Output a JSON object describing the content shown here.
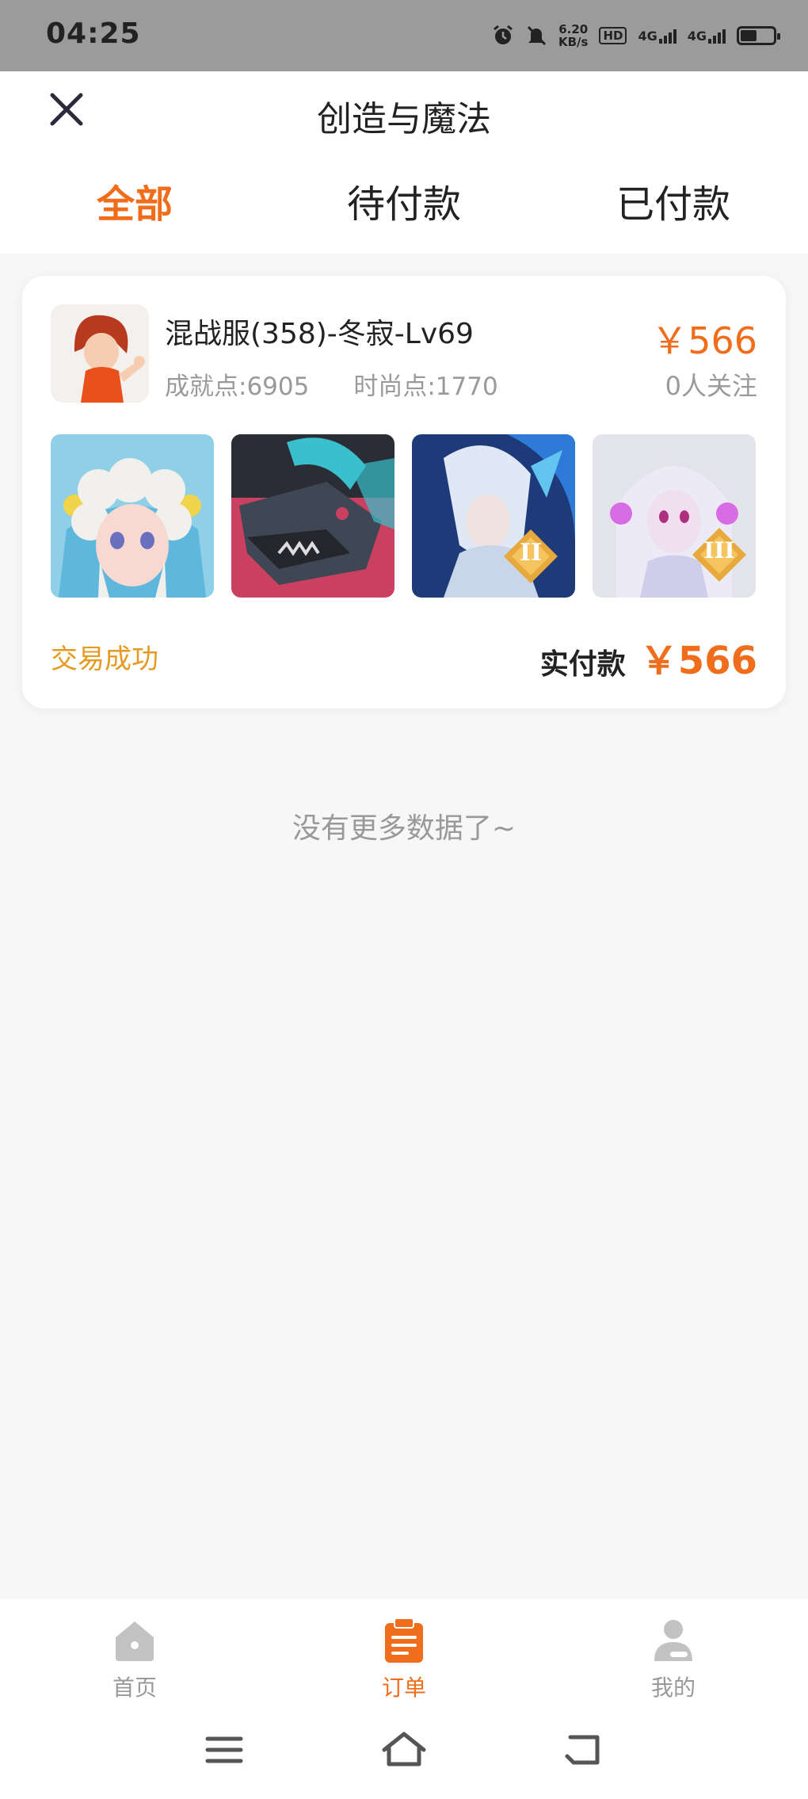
{
  "status_bar": {
    "time": "04:25",
    "speed_value": "6.20",
    "speed_unit": "KB/s",
    "hd_label": "HD",
    "net1": "4G",
    "net2": "4G",
    "battery_level": 0.45,
    "icons": [
      "alarm-icon",
      "mute-icon",
      "signal-icon",
      "battery-icon"
    ]
  },
  "header": {
    "title": "创造与魔法",
    "close_icon": "close-icon",
    "tabs": [
      {
        "label": "全部",
        "active": true
      },
      {
        "label": "待付款",
        "active": false
      },
      {
        "label": "已付款",
        "active": false
      }
    ]
  },
  "order": {
    "title": "混战服(358)-冬寂-Lv69",
    "achievement": "成就点:6905",
    "fashion": "时尚点:1770",
    "price": "￥566",
    "followers": "0人关注",
    "status": "交易成功",
    "paid_label": "实付款",
    "paid_amount": "￥566",
    "thumbs": [
      {
        "name": "character-thumb-1",
        "badge": ""
      },
      {
        "name": "mount-thumb-2",
        "badge": ""
      },
      {
        "name": "character-thumb-3",
        "badge": "II"
      },
      {
        "name": "character-thumb-4",
        "badge": "III"
      }
    ]
  },
  "empty_text": "没有更多数据了~",
  "bottom_nav": [
    {
      "label": "首页",
      "icon": "home-icon",
      "active": false
    },
    {
      "label": "订单",
      "icon": "orders-icon",
      "active": true
    },
    {
      "label": "我的",
      "icon": "profile-icon",
      "active": false
    }
  ],
  "system_nav": [
    "menu-icon",
    "home-nav-icon",
    "back-icon"
  ],
  "colors": {
    "accent": "#f06d1c",
    "success": "#e59a21",
    "muted": "#999999"
  }
}
